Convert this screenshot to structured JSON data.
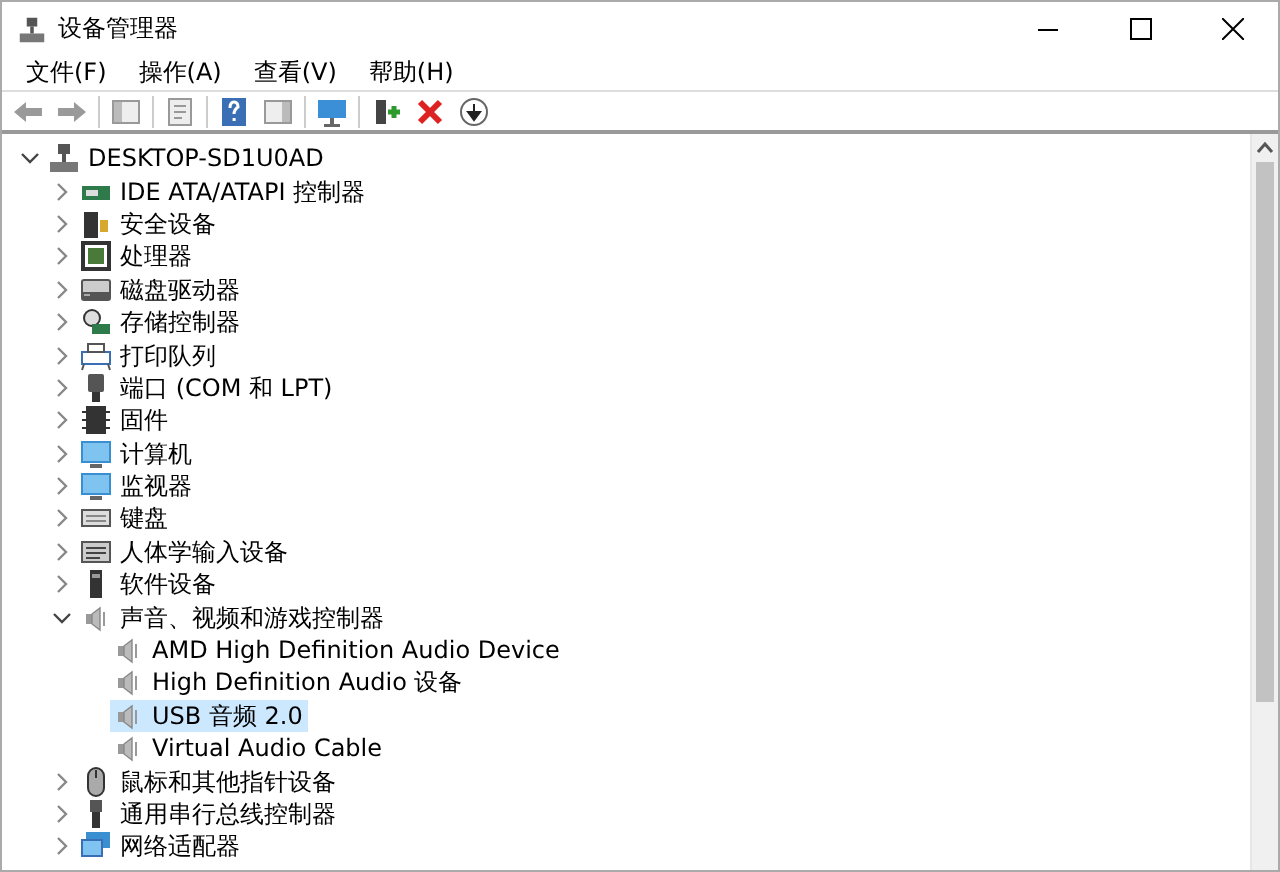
{
  "window": {
    "title": "设备管理器"
  },
  "menu": [
    "文件(F)",
    "操作(A)",
    "查看(V)",
    "帮助(H)"
  ],
  "tree": [
    {
      "label": "DESKTOP-SD1U0AD",
      "kind": "computer",
      "expanded": true,
      "selected": false,
      "children": [
        {
          "label": "IDE ATA/ATAPI 控制器",
          "kind": "ide",
          "expanded": false,
          "selected": false
        },
        {
          "label": "安全设备",
          "kind": "security",
          "expanded": false,
          "selected": false
        },
        {
          "label": "处理器",
          "kind": "cpu",
          "expanded": false,
          "selected": false
        },
        {
          "label": "磁盘驱动器",
          "kind": "disk",
          "expanded": false,
          "selected": false
        },
        {
          "label": "存储控制器",
          "kind": "storage",
          "expanded": false,
          "selected": false
        },
        {
          "label": "打印队列",
          "kind": "printer",
          "expanded": false,
          "selected": false
        },
        {
          "label": "端口 (COM 和 LPT)",
          "kind": "port",
          "expanded": false,
          "selected": false
        },
        {
          "label": "固件",
          "kind": "firmware",
          "expanded": false,
          "selected": false
        },
        {
          "label": "计算机",
          "kind": "monitor",
          "expanded": false,
          "selected": false
        },
        {
          "label": "监视器",
          "kind": "monitor",
          "expanded": false,
          "selected": false
        },
        {
          "label": "键盘",
          "kind": "keyboard",
          "expanded": false,
          "selected": false
        },
        {
          "label": "人体学输入设备",
          "kind": "hid",
          "expanded": false,
          "selected": false
        },
        {
          "label": "软件设备",
          "kind": "software",
          "expanded": false,
          "selected": false
        },
        {
          "label": "声音、视频和游戏控制器",
          "kind": "audio",
          "expanded": true,
          "selected": false,
          "children": [
            {
              "label": "AMD High Definition Audio Device",
              "kind": "audio",
              "selected": false
            },
            {
              "label": "High Definition Audio 设备",
              "kind": "audio",
              "selected": false
            },
            {
              "label": "USB 音频 2.0",
              "kind": "audio",
              "selected": true
            },
            {
              "label": "Virtual Audio Cable",
              "kind": "audio",
              "selected": false
            }
          ]
        },
        {
          "label": "鼠标和其他指针设备",
          "kind": "mouse",
          "expanded": false,
          "selected": false
        },
        {
          "label": "通用串行总线控制器",
          "kind": "usb",
          "expanded": false,
          "selected": false
        },
        {
          "label": "网络适配器",
          "kind": "network",
          "expanded": false,
          "selected": false
        }
      ]
    }
  ]
}
